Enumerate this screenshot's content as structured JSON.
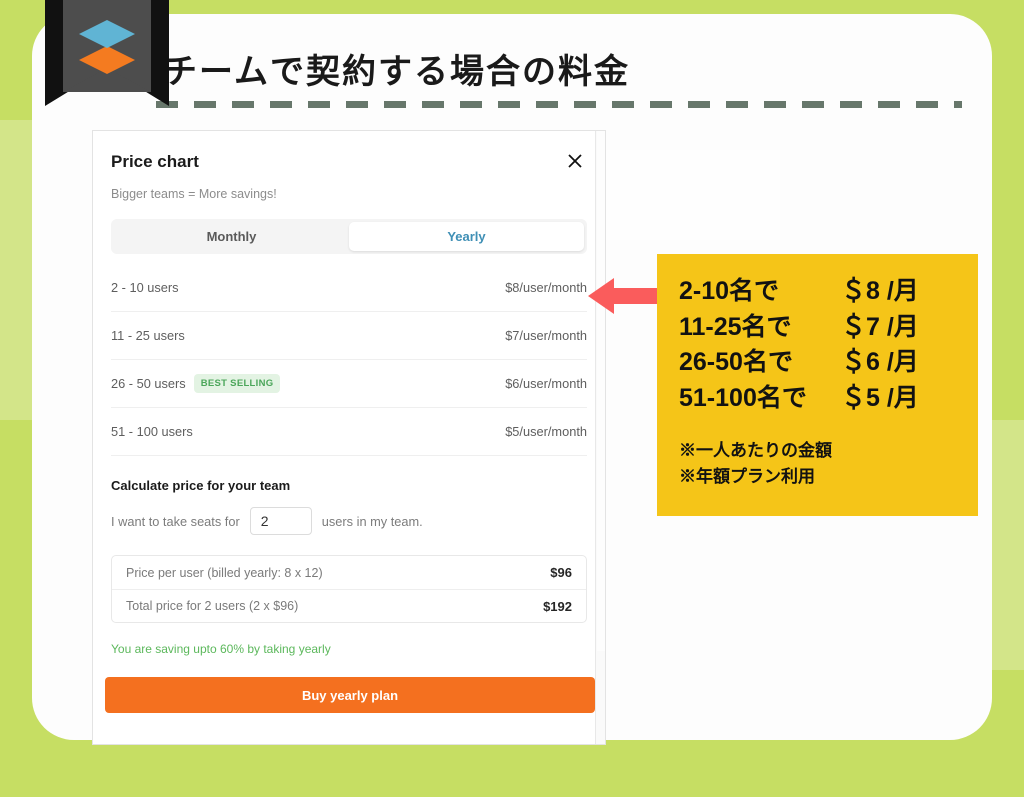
{
  "header": {
    "title": "チームで契約する場合の料金",
    "logo_icon": "stacked-diamonds-logo",
    "ribbon_icon": "bookmark-ribbon"
  },
  "colors": {
    "background_green": "#C6DE63",
    "panel_white": "#FDFDFD",
    "callout_yellow": "#F5C518",
    "arrow_red": "#FA5C5C",
    "button_orange": "#F4701F",
    "accent_blue": "#3F8FB5",
    "badge_green": "#4BA65A",
    "saving_green": "#5CB85C",
    "dash_gray": "#67776B"
  },
  "card": {
    "title": "Price chart",
    "subtitle": "Bigger teams = More savings!",
    "close_icon": "close-icon",
    "toggle": {
      "options": [
        {
          "label": "Monthly",
          "active": false
        },
        {
          "label": "Yearly",
          "active": true
        }
      ]
    },
    "tiers": [
      {
        "range": "2 - 10 users",
        "badge": "",
        "price": "$8/user/month"
      },
      {
        "range": "11 - 25 users",
        "badge": "",
        "price": "$7/user/month"
      },
      {
        "range": "26 - 50 users",
        "badge": "BEST SELLING",
        "price": "$6/user/month"
      },
      {
        "range": "51 - 100 users",
        "badge": "",
        "price": "$5/user/month"
      }
    ],
    "calculator": {
      "title": "Calculate price for your team",
      "prefix_text": "I want to take seats for",
      "seats_value": "2",
      "seats_placeholder": "2",
      "suffix_text": "users in my team.",
      "rows": [
        {
          "label": "Price per user (billed yearly: 8 x 12)",
          "value": "$96"
        },
        {
          "label": "Total price for 2 users (2 x $96)",
          "value": "$192"
        }
      ]
    },
    "saving_text": "You are saving upto 60% by taking yearly",
    "buy_button": "Buy yearly plan"
  },
  "callout": {
    "arrow_icon": "left-arrow-icon",
    "lines": [
      {
        "range": "2-10名で",
        "price": "＄8 /月"
      },
      {
        "range": "11-25名で",
        "price": "＄7 /月"
      },
      {
        "range": "26-50名で",
        "price": "＄6 /月"
      },
      {
        "range": "51-100名で",
        "price": "＄5 /月"
      }
    ],
    "notes": [
      "※一人あたりの金額",
      "※年額プラン利用"
    ]
  }
}
